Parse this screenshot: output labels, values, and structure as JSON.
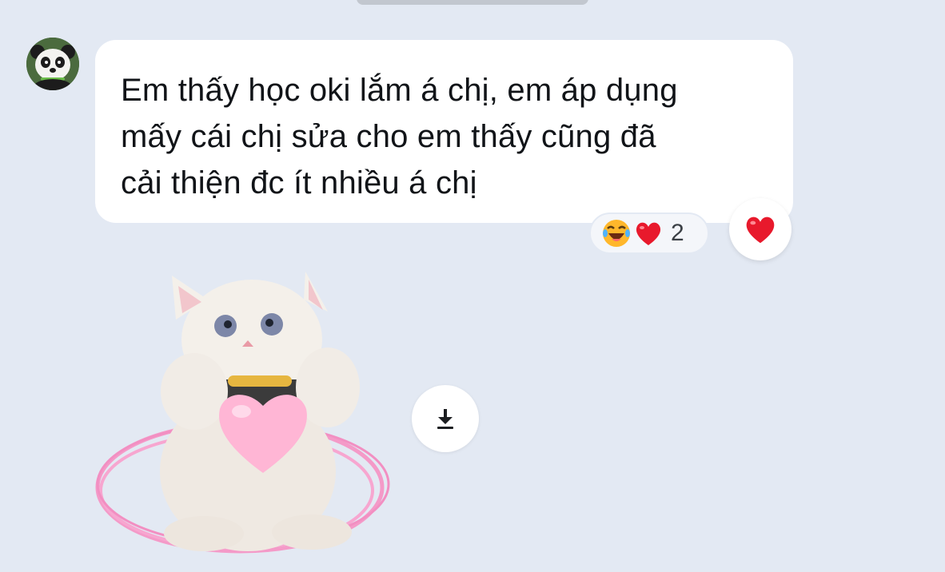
{
  "message": {
    "lines": [
      "Em thấy học oki lắm á chị, em áp dụng",
      "mấy cái chị sửa cho em thấy cũng đã",
      "cải thiện đc ít nhiều á chị"
    ]
  },
  "reactions": {
    "emojis": [
      "laughing-crying-face",
      "red-heart"
    ],
    "count": "2"
  },
  "react_button": {
    "icon": "red-heart"
  },
  "sticker": {
    "description_icon": "white-cat-holding-pink-heart-sticker"
  },
  "colors": {
    "background": "#e3e9f3",
    "bubble": "#ffffff",
    "text": "#111418",
    "heart": "#e8192c",
    "sticker_ring": "#f49ac8"
  }
}
